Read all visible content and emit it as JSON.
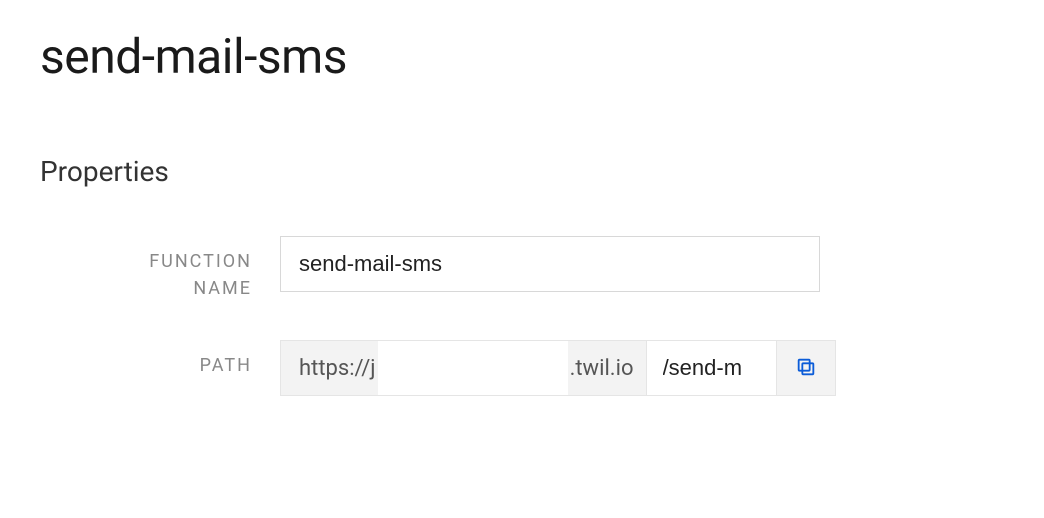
{
  "page": {
    "title": "send-mail-sms"
  },
  "properties": {
    "heading": "Properties",
    "function_name": {
      "label": "FUNCTION NAME",
      "value": "send-mail-sms"
    },
    "path": {
      "label": "PATH",
      "prefix_protocol": "https://j",
      "prefix_domain_suffix": ".twil.io",
      "value": "/send-m"
    }
  }
}
